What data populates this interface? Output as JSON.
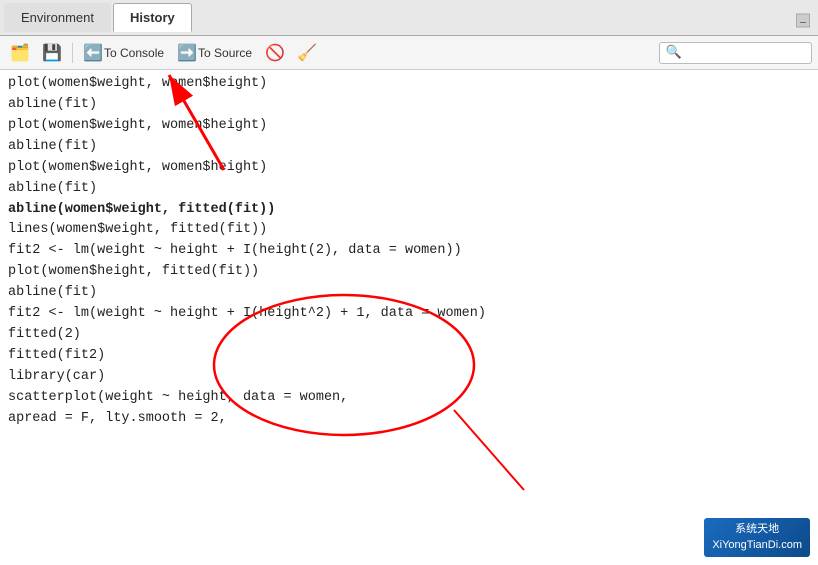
{
  "tabs": [
    {
      "label": "Environment",
      "active": false
    },
    {
      "label": "History",
      "active": true
    }
  ],
  "toolbar": {
    "buttons": [
      {
        "id": "load",
        "icon": "🗂️",
        "label": "",
        "title": "Load"
      },
      {
        "id": "save",
        "icon": "💾",
        "label": "",
        "title": "Save"
      },
      {
        "id": "to-console",
        "icon": "⬅️",
        "label": "To Console",
        "title": "Send to Console"
      },
      {
        "id": "to-source",
        "icon": "➡️",
        "label": "To Source",
        "title": "Send to Source"
      },
      {
        "id": "remove",
        "icon": "🚫",
        "label": "",
        "title": "Remove"
      },
      {
        "id": "broom",
        "icon": "🧹",
        "label": "",
        "title": "Clear"
      }
    ],
    "search_placeholder": ""
  },
  "code_lines": [
    {
      "text": "plot(women$weight, women$height)",
      "bold": false
    },
    {
      "text": "abline(fit)",
      "bold": false
    },
    {
      "text": "plot(women$weight, women$height)",
      "bold": false
    },
    {
      "text": "abline(fit)",
      "bold": false
    },
    {
      "text": "plot(women$weight, women$height)",
      "bold": false
    },
    {
      "text": "abline(fit)",
      "bold": false
    },
    {
      "text": "abline(women$weight, fitted(fit))",
      "bold": true
    },
    {
      "text": "lines(women$weight, fitted(fit))",
      "bold": false
    },
    {
      "text": "fit2 <- lm(weight ~ height + I(height(2), data = women))",
      "bold": false
    },
    {
      "text": "plot(women$height, fitted(fit))",
      "bold": false
    },
    {
      "text": "abline(fit)",
      "bold": false
    },
    {
      "text": "fit2 <- lm(weight ~ height + I(height^2) + 1, data = women)",
      "bold": false
    },
    {
      "text": "fitted(2)",
      "bold": false
    },
    {
      "text": "fitted(fit2)",
      "bold": false
    },
    {
      "text": "library(car)",
      "bold": false
    },
    {
      "text": "scatterplot(weight ~ height, data = women,",
      "bold": false
    },
    {
      "text": "apread = F, lty.smooth = 2,",
      "bold": false
    }
  ],
  "watermark": {
    "line1": "系统天地",
    "line2": "XiYongTianDi.com"
  }
}
